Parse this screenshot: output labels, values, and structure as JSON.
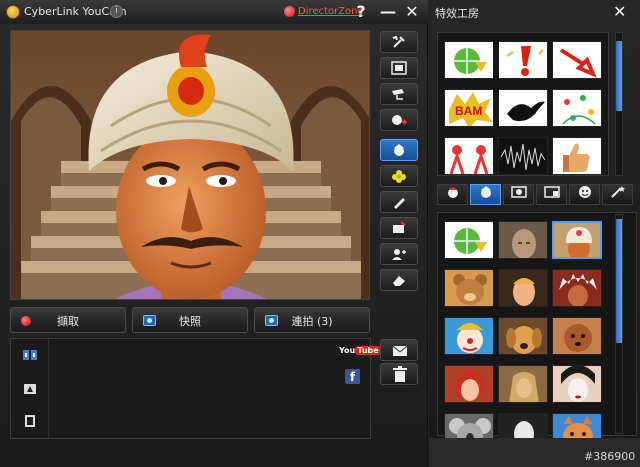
{
  "window": {
    "title": "CyberLink YouCam",
    "directorzone": "DirectorZone",
    "help": "?",
    "minimize": "—",
    "close": "✕"
  },
  "capture": {
    "record_label": "擷取",
    "snapshot_label": "快照",
    "burst_label": "連拍 (3)"
  },
  "gallery": {
    "youtube_you": "You",
    "youtube_tube": "Tube",
    "facebook": "f"
  },
  "effects_panel": {
    "title": "特效工房",
    "close": "✕",
    "emotion_tiles": [
      "download-globe",
      "exclamation",
      "arrow-red",
      "bam",
      "bird-silhouette",
      "flowers",
      "cheering-figures",
      "waveform",
      "thumbs-up"
    ],
    "tabs": [
      "avatar-tab",
      "face-tab",
      "frame-tab",
      "scene-tab",
      "emoticon-tab",
      "magic-tab"
    ],
    "face_tiles": [
      "download-globe",
      "stone-statue",
      "turban-genie",
      "teddy-bear",
      "blond-face",
      "native-chief",
      "clown",
      "golden-dog",
      "poodle",
      "redhead-girl",
      "sphinx",
      "geisha",
      "koala",
      "marble-bust",
      "ginger-cat"
    ]
  },
  "colors": {
    "accent_blue": "#2f79d0",
    "record_red": "#dd0000",
    "directorzone_red": "#ff5a3a"
  },
  "watermark": "#386900"
}
